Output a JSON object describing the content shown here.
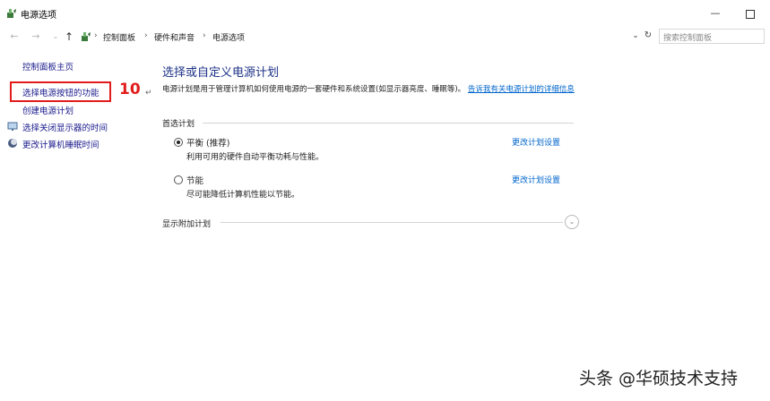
{
  "window": {
    "title": "电源选项",
    "minimize_glyph": "—",
    "app_icon": "power-options-icon"
  },
  "nav": {
    "back_glyph": "←",
    "forward_glyph": "→",
    "recent_glyph": "⌄",
    "up_glyph": "↑",
    "breadcrumb": [
      "控制面板",
      "硬件和声音",
      "电源选项"
    ],
    "separator": "›",
    "dropdown_glyph": "⌄",
    "refresh_glyph": "↻",
    "search_placeholder": "搜索控制面板"
  },
  "sidebar": {
    "home": "控制面板主页",
    "items": [
      {
        "label": "选择电源按钮的功能",
        "icon": null
      },
      {
        "label": "创建电源计划",
        "icon": null
      },
      {
        "label": "选择关闭显示器的时间",
        "icon": "monitor-icon"
      },
      {
        "label": "更改计算机睡眠时间",
        "icon": "moon-icon"
      }
    ]
  },
  "annotation": {
    "step_number": "10",
    "para_mark": "↵",
    "highlight_color": "#e21b1b"
  },
  "main": {
    "title": "选择或自定义电源计划",
    "description": "电源计划是用于管理计算机如何使用电源的一套硬件和系统设置(如显示器亮度、睡眠等)。",
    "description_link": "告诉我有关电源计划的详细信息",
    "preferred_label": "首选计划",
    "plans": [
      {
        "name": "平衡 (推荐)",
        "description": "利用可用的硬件自动平衡功耗与性能。",
        "link": "更改计划设置",
        "selected": true
      },
      {
        "name": "节能",
        "description": "尽可能降低计算机性能以节能。",
        "link": "更改计划设置",
        "selected": false
      }
    ],
    "additional_label": "显示附加计划",
    "expand_glyph": "⌄"
  },
  "watermark": "头条 @华硕技术支持",
  "colors": {
    "link": "#0066cc",
    "title": "#1e3287",
    "sidebar_link": "#1a1a8c",
    "accent_red": "#e21b1b"
  }
}
